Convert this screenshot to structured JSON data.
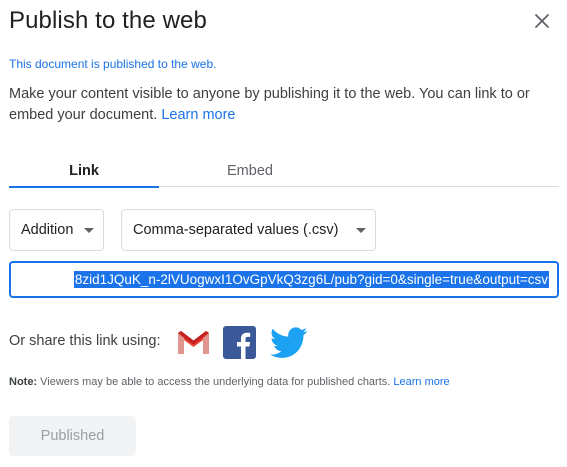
{
  "dialog": {
    "title": "Publish to the web",
    "close_icon": "close-icon"
  },
  "status": {
    "published_message": "This document is published to the web."
  },
  "description": {
    "text": "Make your content visible to anyone by publishing it to the web. You can link to or embed your document.",
    "learn_more": "Learn more"
  },
  "tabs": [
    {
      "label": "Link",
      "active": true
    },
    {
      "label": "Embed",
      "active": false
    }
  ],
  "options": {
    "sheet_selected": "Addition",
    "format_selected": "Comma-separated values (.csv)"
  },
  "url": {
    "value": "8zid1JQuK_n-2lVUogwxI1OvGpVkQ3zg6L/pub?gid=0&single=true&output=csv"
  },
  "share": {
    "label": "Or share this link using:",
    "icons": [
      "gmail-icon",
      "facebook-icon",
      "twitter-icon"
    ]
  },
  "note": {
    "prefix": "Note:",
    "text": " Viewers may be able to access the underlying data for published charts. ",
    "learn_more": "Learn more"
  },
  "footer": {
    "published_button": "Published"
  },
  "colors": {
    "accent": "#1a73e8",
    "gmail_red": "#ea4335",
    "facebook_blue": "#3b5998",
    "twitter_blue": "#1da1f2"
  }
}
